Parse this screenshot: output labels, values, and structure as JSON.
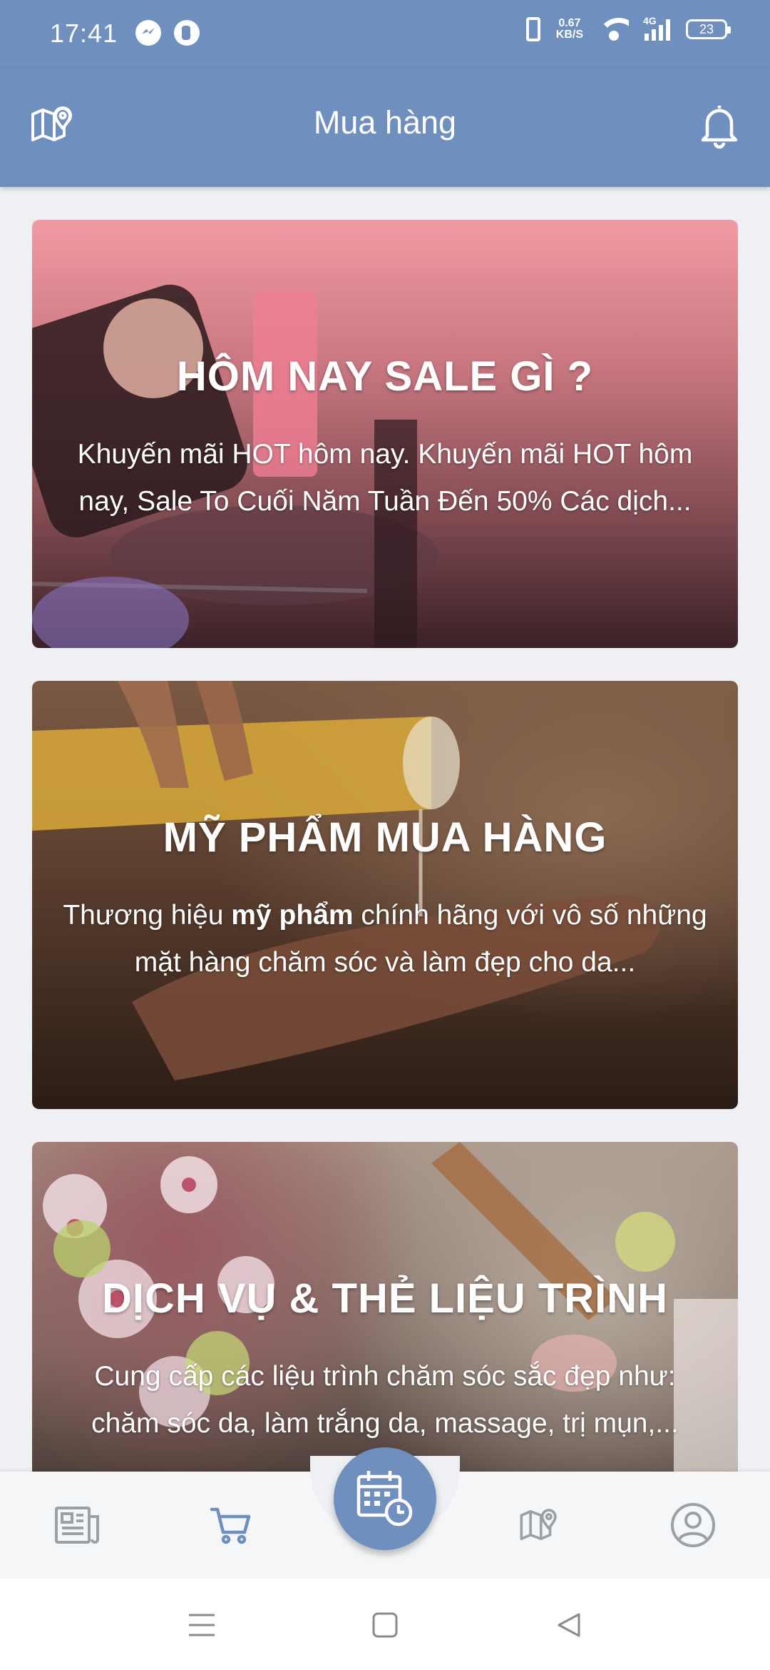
{
  "status_bar": {
    "time": "17:41",
    "network_speed_value": "0.67",
    "network_speed_unit": "KB/S",
    "network_type": "4G",
    "battery_level": "23"
  },
  "app_bar": {
    "title": "Mua hàng",
    "left_icon": "map-pin-icon",
    "right_icon": "bell-icon"
  },
  "cards": [
    {
      "title": "HÔM NAY SALE GÌ ?",
      "description": "Khuyến mãi HOT hôm nay. Khuyến mãi HOT hôm nay, Sale To Cuối Năm Tuần Đến 50% Các dịch..."
    },
    {
      "title": "MỸ PHẨM MUA HÀNG",
      "description_prefix": "Thương hiệu ",
      "description_bold": "mỹ phẩm",
      "description_suffix": " chính hãng với vô số những mặt hàng chăm sóc và làm đẹp cho da..."
    },
    {
      "title": "DỊCH VỤ & THẺ LIỆU TRÌNH",
      "description": "Cung cấp các liệu trình chăm sóc sắc đẹp như: chăm sóc da, làm trắng da, massage, trị mụn,..."
    }
  ],
  "bottom_nav": {
    "items": [
      "news-icon",
      "cart-icon",
      "calendar-clock-icon",
      "map-icon",
      "user-icon"
    ],
    "active": "cart-icon",
    "active_color": "#6f8fbf",
    "inactive_color": "#9aa0a8"
  },
  "colors": {
    "primary": "#6f8fbf",
    "background": "#eef0f4"
  }
}
